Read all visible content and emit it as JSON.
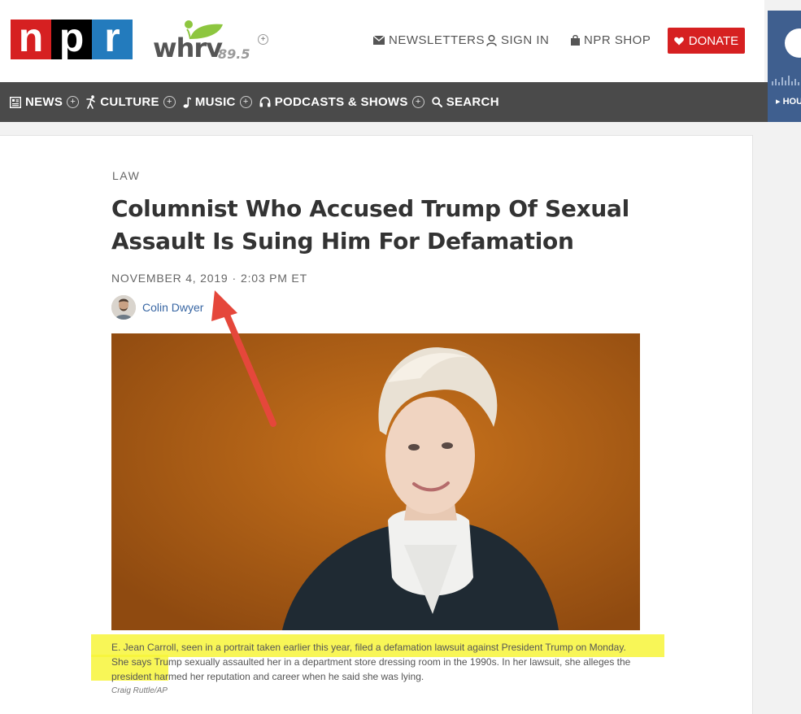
{
  "header": {
    "logo": {
      "letters": [
        "n",
        "p",
        "r"
      ],
      "colors": [
        "#d62021",
        "#000000",
        "#237bbd"
      ]
    },
    "station": {
      "name": "whrv",
      "frequency": "89.5",
      "add_icon": "+"
    },
    "links": {
      "newsletters": "NEWSLETTERS",
      "sign_in": "SIGN IN",
      "shop": "NPR SHOP"
    },
    "donate_label": "DONATE",
    "player": {
      "label": "HOU"
    }
  },
  "nav": {
    "items": [
      {
        "label": "NEWS",
        "icon": "newspaper-icon",
        "expand": "+"
      },
      {
        "label": "CULTURE",
        "icon": "dancer-icon",
        "expand": "+"
      },
      {
        "label": "MUSIC",
        "icon": "music-note-icon",
        "expand": "+"
      },
      {
        "label": "PODCASTS & SHOWS",
        "icon": "headphones-icon",
        "expand": "+"
      },
      {
        "label": "SEARCH",
        "icon": "search-icon"
      }
    ]
  },
  "article": {
    "slug": "LAW",
    "headline": "Columnist Who Accused Trump Of Sexual Assault Is Suing Him For Defamation",
    "date": "NOVEMBER 4, 2019",
    "separator": "·",
    "time": "2:03 PM ET",
    "author": "Colin Dwyer",
    "caption": "E. Jean Carroll, seen in a portrait taken earlier this year, filed a defamation lawsuit against President Trump on Monday. She says Trump sexually assaulted her in a department store dressing room in the 1990s. In her lawsuit, she alleges the president harmed her reputation and career when he said she was lying.",
    "credit": "Craig Ruttle/AP"
  },
  "colors": {
    "nav_background": "#4a4a4a",
    "donate_red": "#d62021",
    "annotation_arrow": "#e5473b",
    "highlight": "#f7f43a",
    "author_link": "#3866a3"
  }
}
